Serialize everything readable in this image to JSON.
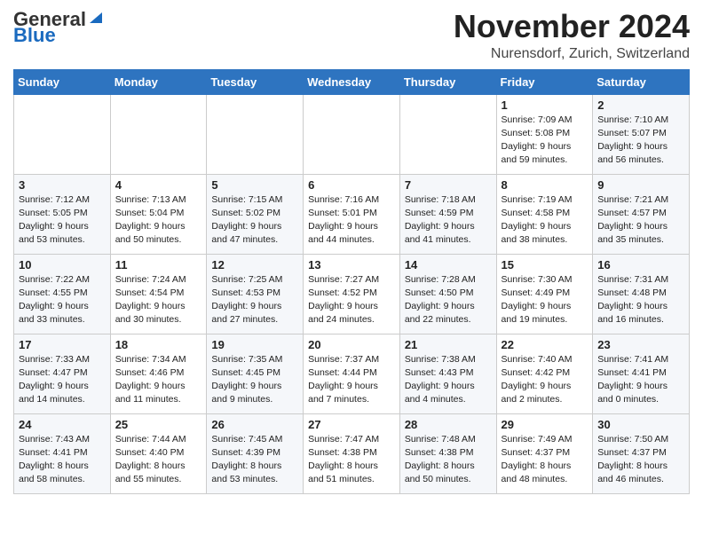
{
  "header": {
    "logo_general": "General",
    "logo_blue": "Blue",
    "month_title": "November 2024",
    "location": "Nurensdorf, Zurich, Switzerland"
  },
  "weekdays": [
    "Sunday",
    "Monday",
    "Tuesday",
    "Wednesday",
    "Thursday",
    "Friday",
    "Saturday"
  ],
  "weeks": [
    [
      {
        "day": "",
        "info": ""
      },
      {
        "day": "",
        "info": ""
      },
      {
        "day": "",
        "info": ""
      },
      {
        "day": "",
        "info": ""
      },
      {
        "day": "",
        "info": ""
      },
      {
        "day": "1",
        "info": "Sunrise: 7:09 AM\nSunset: 5:08 PM\nDaylight: 9 hours\nand 59 minutes."
      },
      {
        "day": "2",
        "info": "Sunrise: 7:10 AM\nSunset: 5:07 PM\nDaylight: 9 hours\nand 56 minutes."
      }
    ],
    [
      {
        "day": "3",
        "info": "Sunrise: 7:12 AM\nSunset: 5:05 PM\nDaylight: 9 hours\nand 53 minutes."
      },
      {
        "day": "4",
        "info": "Sunrise: 7:13 AM\nSunset: 5:04 PM\nDaylight: 9 hours\nand 50 minutes."
      },
      {
        "day": "5",
        "info": "Sunrise: 7:15 AM\nSunset: 5:02 PM\nDaylight: 9 hours\nand 47 minutes."
      },
      {
        "day": "6",
        "info": "Sunrise: 7:16 AM\nSunset: 5:01 PM\nDaylight: 9 hours\nand 44 minutes."
      },
      {
        "day": "7",
        "info": "Sunrise: 7:18 AM\nSunset: 4:59 PM\nDaylight: 9 hours\nand 41 minutes."
      },
      {
        "day": "8",
        "info": "Sunrise: 7:19 AM\nSunset: 4:58 PM\nDaylight: 9 hours\nand 38 minutes."
      },
      {
        "day": "9",
        "info": "Sunrise: 7:21 AM\nSunset: 4:57 PM\nDaylight: 9 hours\nand 35 minutes."
      }
    ],
    [
      {
        "day": "10",
        "info": "Sunrise: 7:22 AM\nSunset: 4:55 PM\nDaylight: 9 hours\nand 33 minutes."
      },
      {
        "day": "11",
        "info": "Sunrise: 7:24 AM\nSunset: 4:54 PM\nDaylight: 9 hours\nand 30 minutes."
      },
      {
        "day": "12",
        "info": "Sunrise: 7:25 AM\nSunset: 4:53 PM\nDaylight: 9 hours\nand 27 minutes."
      },
      {
        "day": "13",
        "info": "Sunrise: 7:27 AM\nSunset: 4:52 PM\nDaylight: 9 hours\nand 24 minutes."
      },
      {
        "day": "14",
        "info": "Sunrise: 7:28 AM\nSunset: 4:50 PM\nDaylight: 9 hours\nand 22 minutes."
      },
      {
        "day": "15",
        "info": "Sunrise: 7:30 AM\nSunset: 4:49 PM\nDaylight: 9 hours\nand 19 minutes."
      },
      {
        "day": "16",
        "info": "Sunrise: 7:31 AM\nSunset: 4:48 PM\nDaylight: 9 hours\nand 16 minutes."
      }
    ],
    [
      {
        "day": "17",
        "info": "Sunrise: 7:33 AM\nSunset: 4:47 PM\nDaylight: 9 hours\nand 14 minutes."
      },
      {
        "day": "18",
        "info": "Sunrise: 7:34 AM\nSunset: 4:46 PM\nDaylight: 9 hours\nand 11 minutes."
      },
      {
        "day": "19",
        "info": "Sunrise: 7:35 AM\nSunset: 4:45 PM\nDaylight: 9 hours\nand 9 minutes."
      },
      {
        "day": "20",
        "info": "Sunrise: 7:37 AM\nSunset: 4:44 PM\nDaylight: 9 hours\nand 7 minutes."
      },
      {
        "day": "21",
        "info": "Sunrise: 7:38 AM\nSunset: 4:43 PM\nDaylight: 9 hours\nand 4 minutes."
      },
      {
        "day": "22",
        "info": "Sunrise: 7:40 AM\nSunset: 4:42 PM\nDaylight: 9 hours\nand 2 minutes."
      },
      {
        "day": "23",
        "info": "Sunrise: 7:41 AM\nSunset: 4:41 PM\nDaylight: 9 hours\nand 0 minutes."
      }
    ],
    [
      {
        "day": "24",
        "info": "Sunrise: 7:43 AM\nSunset: 4:41 PM\nDaylight: 8 hours\nand 58 minutes."
      },
      {
        "day": "25",
        "info": "Sunrise: 7:44 AM\nSunset: 4:40 PM\nDaylight: 8 hours\nand 55 minutes."
      },
      {
        "day": "26",
        "info": "Sunrise: 7:45 AM\nSunset: 4:39 PM\nDaylight: 8 hours\nand 53 minutes."
      },
      {
        "day": "27",
        "info": "Sunrise: 7:47 AM\nSunset: 4:38 PM\nDaylight: 8 hours\nand 51 minutes."
      },
      {
        "day": "28",
        "info": "Sunrise: 7:48 AM\nSunset: 4:38 PM\nDaylight: 8 hours\nand 50 minutes."
      },
      {
        "day": "29",
        "info": "Sunrise: 7:49 AM\nSunset: 4:37 PM\nDaylight: 8 hours\nand 48 minutes."
      },
      {
        "day": "30",
        "info": "Sunrise: 7:50 AM\nSunset: 4:37 PM\nDaylight: 8 hours\nand 46 minutes."
      }
    ]
  ]
}
